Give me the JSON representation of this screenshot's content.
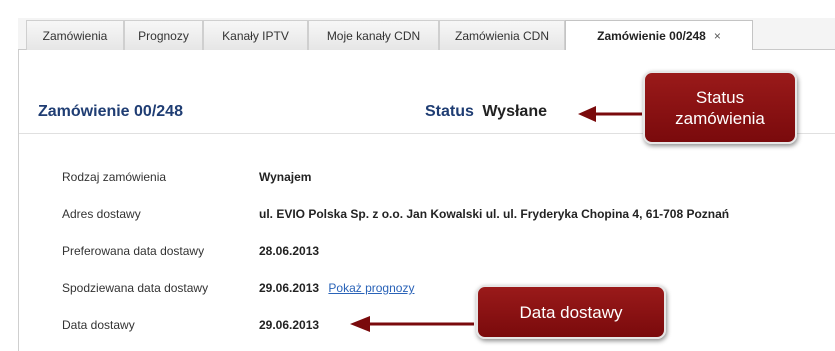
{
  "tabs": [
    {
      "label": "Zamówienia"
    },
    {
      "label": "Prognozy"
    },
    {
      "label": "Kanały IPTV"
    },
    {
      "label": "Moje kanały CDN"
    },
    {
      "label": "Zamówienia CDN"
    },
    {
      "label": "Zamówienie 00/248",
      "active": true,
      "close": "×"
    }
  ],
  "order": {
    "title": "Zamówienie 00/248",
    "status_label": "Status",
    "status_value": "Wysłane"
  },
  "details": {
    "rows": [
      {
        "label": "Rodzaj zamówienia",
        "value": "Wynajem"
      },
      {
        "label": "Adres dostawy",
        "value": "ul. EVIO Polska Sp. z o.o. Jan Kowalski ul. ul. Fryderyka Chopina 4, 61-708 Poznań"
      },
      {
        "label": "Preferowana data dostawy",
        "value": "28.06.2013"
      },
      {
        "label": "Spodziewana data dostawy",
        "value": "29.06.2013",
        "link": "Pokaż prognozy"
      },
      {
        "label": "Data dostawy",
        "value": "29.06.2013"
      }
    ]
  },
  "annotations": {
    "status_callout": "Status zamówienia",
    "delivery_callout": "Data dostawy"
  },
  "colors": {
    "title": "#1f3d73",
    "callout": "#8b1214",
    "link": "#2a63b8"
  }
}
